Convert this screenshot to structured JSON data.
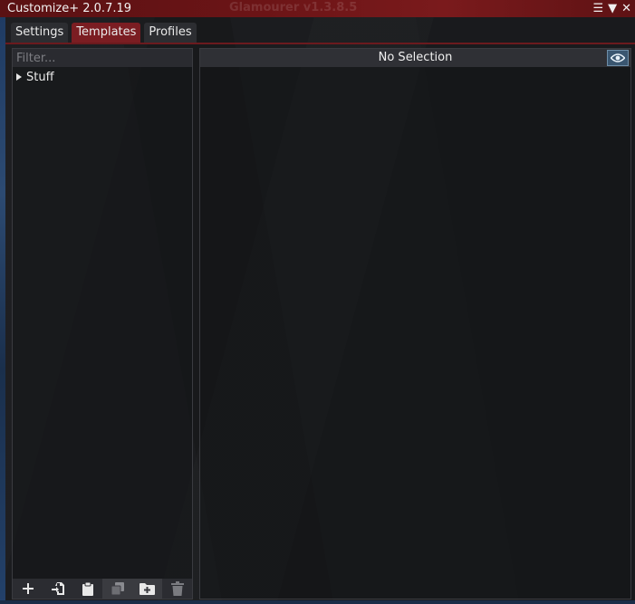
{
  "window": {
    "title": "Customize+ 2.0.7.19",
    "background_window_title": "Glamourer v1.3.8.5"
  },
  "title_controls": {
    "menu_glyph": "☰",
    "collapse_glyph": "▼",
    "close_glyph": "✕"
  },
  "tabs": [
    {
      "label": "Settings",
      "active": false
    },
    {
      "label": "Templates",
      "active": true
    },
    {
      "label": "Profiles",
      "active": false
    }
  ],
  "sidebar": {
    "filter_placeholder": "Filter...",
    "filter_value": "",
    "tree": [
      {
        "label": "Stuff",
        "expanded": false
      }
    ],
    "toolbar": [
      {
        "icon": "plus-icon"
      },
      {
        "icon": "import-icon"
      },
      {
        "icon": "clipboard-icon"
      },
      {
        "icon": "duplicate-icon"
      },
      {
        "icon": "new-folder-icon"
      },
      {
        "icon": "trash-icon"
      }
    ]
  },
  "main": {
    "header": "No Selection",
    "eye_icon": "eye-icon"
  },
  "colors": {
    "titlebar": "#6b1416",
    "active_tab": "#7b1d22",
    "inactive_tab": "#2c2d31",
    "panel_header": "#2f3035",
    "eye_button": "#3a5670"
  }
}
